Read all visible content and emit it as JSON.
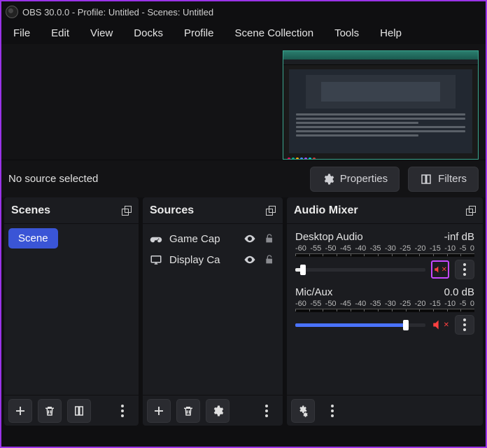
{
  "window": {
    "title": "OBS 30.0.0 - Profile: Untitled - Scenes: Untitled"
  },
  "menu": [
    "File",
    "Edit",
    "View",
    "Docks",
    "Profile",
    "Scene Collection",
    "Tools",
    "Help"
  ],
  "toolbar": {
    "no_source": "No source selected",
    "properties": "Properties",
    "filters": "Filters"
  },
  "panels": {
    "scenes": {
      "title": "Scenes",
      "items": [
        "Scene"
      ]
    },
    "sources": {
      "title": "Sources",
      "items": [
        {
          "icon": "gamepad",
          "label": "Game Cap"
        },
        {
          "icon": "display",
          "label": "Display Ca"
        }
      ]
    },
    "mixer": {
      "title": "Audio Mixer",
      "channels": [
        {
          "name": "Desktop Audio",
          "db": "-inf dB",
          "fill_pct": 8,
          "thumb_pct": 6,
          "fill_color": "#e8e8e8",
          "muted": true,
          "highlight": true
        },
        {
          "name": "Mic/Aux",
          "db": "0.0 dB",
          "fill_pct": 86,
          "thumb_pct": 85,
          "fill_color": "#4a73ff",
          "muted": true,
          "highlight": false
        }
      ],
      "scale": [
        "-60",
        "-55",
        "-50",
        "-45",
        "-40",
        "-35",
        "-30",
        "-25",
        "-20",
        "-15",
        "-10",
        "-5",
        "0"
      ]
    }
  }
}
